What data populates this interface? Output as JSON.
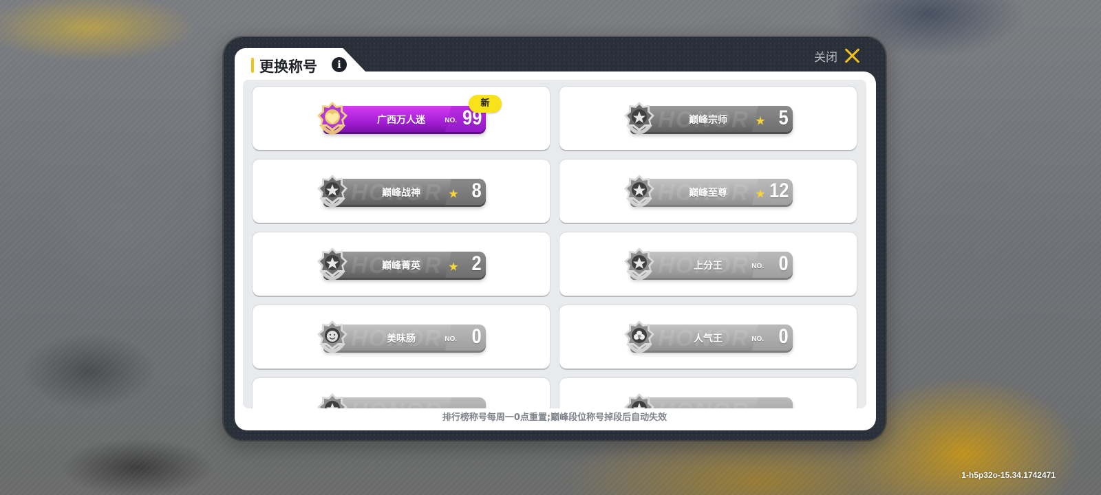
{
  "modal": {
    "title": "更换称号",
    "close_label": "关闭",
    "footer_note": "排行榜称号每周一0点重置;巅峰段位称号掉段后自动失效"
  },
  "titles": [
    {
      "label": "广西万人迷",
      "prefix": "NO.",
      "number": "99",
      "style": "purple",
      "badge": "新",
      "emblem": "heart-emblem-icon"
    },
    {
      "label": "巅峰宗师",
      "prefix": "",
      "number": "5",
      "style": "dark",
      "star": true,
      "emblem": "peak-star-emblem-icon"
    },
    {
      "label": "巅峰战神",
      "prefix": "",
      "number": "8",
      "style": "dark",
      "star": true,
      "emblem": "peak-star-emblem-icon"
    },
    {
      "label": "巅峰至尊",
      "prefix": "",
      "number": "12",
      "style": "light",
      "star": true,
      "emblem": "peak-star-emblem-icon"
    },
    {
      "label": "巅峰菁英",
      "prefix": "",
      "number": "2",
      "style": "dark",
      "star": true,
      "emblem": "peak-star-emblem-icon"
    },
    {
      "label": "上分王",
      "prefix": "NO.",
      "number": "0",
      "style": "light",
      "emblem": "peak-star-emblem-icon"
    },
    {
      "label": "美味肠",
      "prefix": "NO.",
      "number": "0",
      "style": "light",
      "emblem": "sausage-face-emblem-icon"
    },
    {
      "label": "人气王",
      "prefix": "NO.",
      "number": "0",
      "style": "light",
      "emblem": "flower-emblem-icon"
    },
    {
      "label": "",
      "prefix": "",
      "number": "",
      "style": "light",
      "emblem": "peak-star-emblem-icon"
    },
    {
      "label": "",
      "prefix": "",
      "number": "",
      "style": "light",
      "emblem": "peak-star-emblem-icon"
    }
  ],
  "version": "1-h5p32o-15.34.1742471",
  "colors": {
    "accent_yellow": "#f3c21a",
    "modal_bg": "#2a3039",
    "purple_plate": "#a51fd6",
    "badge_yellow": "#f8e21a"
  }
}
